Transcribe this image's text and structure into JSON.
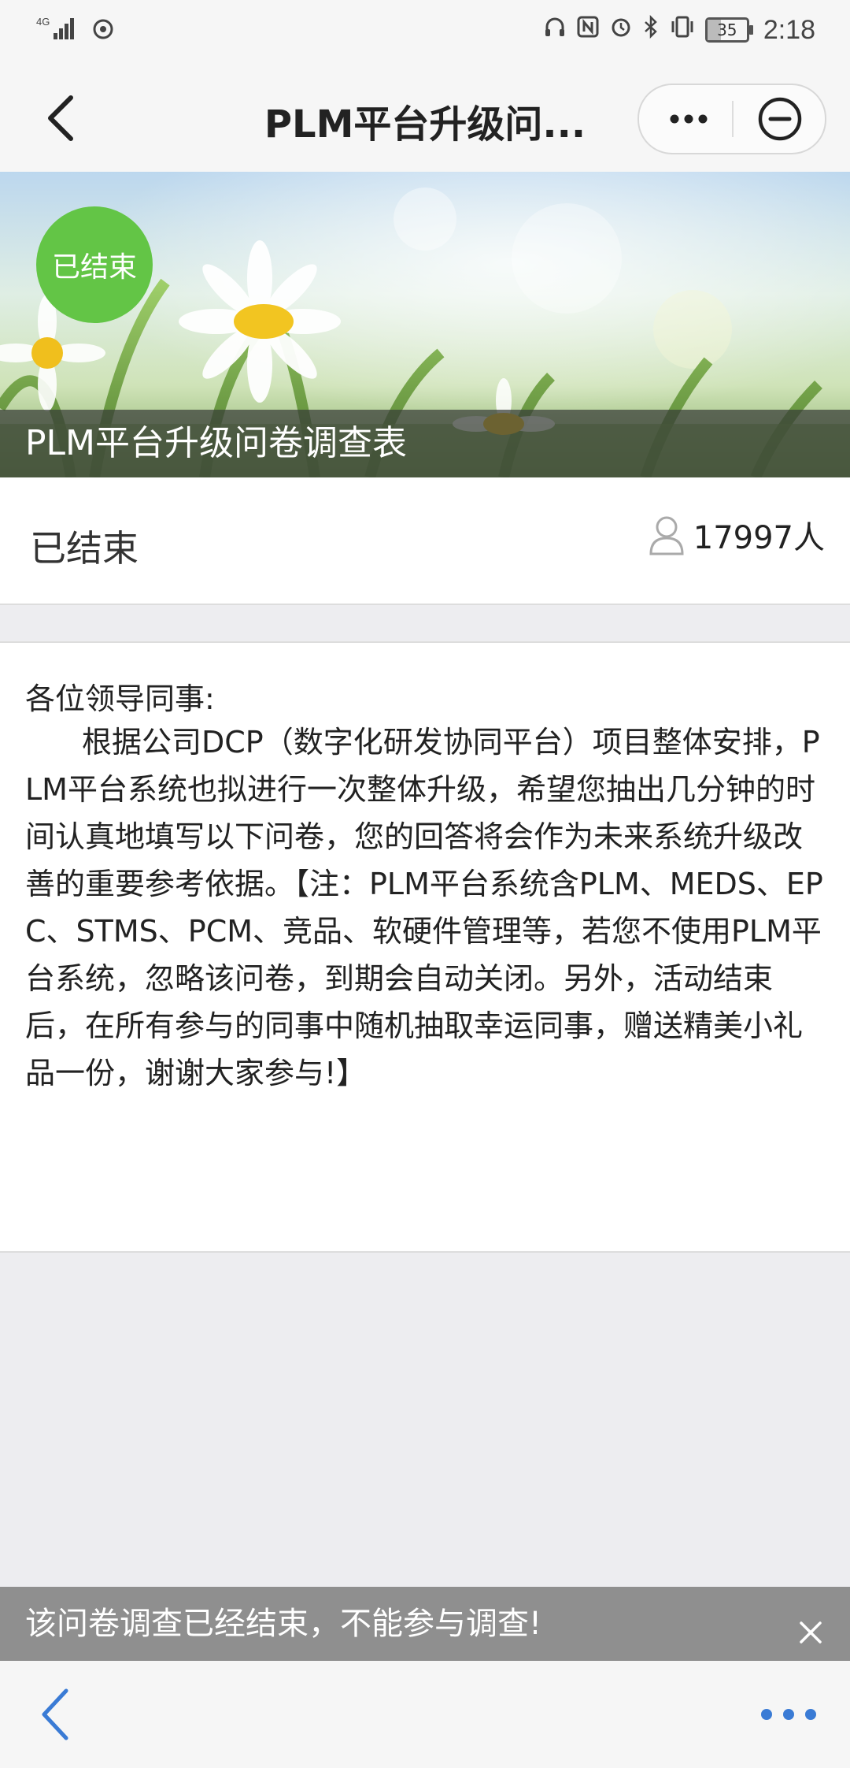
{
  "status_bar": {
    "network": "4G",
    "time": "2:18",
    "battery": "35",
    "icons": [
      "signal-icon",
      "hotspot-icon",
      "headphones-icon",
      "nfc-icon",
      "alarm-icon",
      "bluetooth-icon",
      "vibrate-icon",
      "battery-icon"
    ]
  },
  "header": {
    "title": "PLM平台升级问...",
    "back_icon": "chevron-left-icon",
    "more_icon": "more-dots-icon",
    "close_icon": "minus-circle-icon"
  },
  "banner": {
    "status_badge": "已结束",
    "caption": "PLM平台升级问卷调查表",
    "badge_color": "#63c546"
  },
  "info": {
    "status": "已结束",
    "participants": "17997人",
    "participants_icon": "person-icon"
  },
  "description": {
    "greeting": "各位领导同事:",
    "body": "根据公司DCP（数字化研发协同平台）项目整体安排，PLM平台系统也拟进行一次整体升级，希望您抽出几分钟的时间认真地填写以下问卷，您的回答将会作为未来系统升级改善的重要参考依据。【注：PLM平台系统含PLM、MEDS、EPC、STMS、PCM、竞品、软硬件管理等，若您不使用PLM平台系统，忽略该问卷，到期会自动关闭。另外，活动结束后，在所有参与的同事中随机抽取幸运同事，赠送精美小礼品一份，谢谢大家参与!】"
  },
  "toast": {
    "message": "该问卷调查已经结束，不能参与调查!",
    "close_icon": "close-icon"
  },
  "bottom_bar": {
    "back_icon": "chevron-left-icon",
    "more_icon": "more-dots-icon",
    "accent": "#3a7bd5"
  }
}
